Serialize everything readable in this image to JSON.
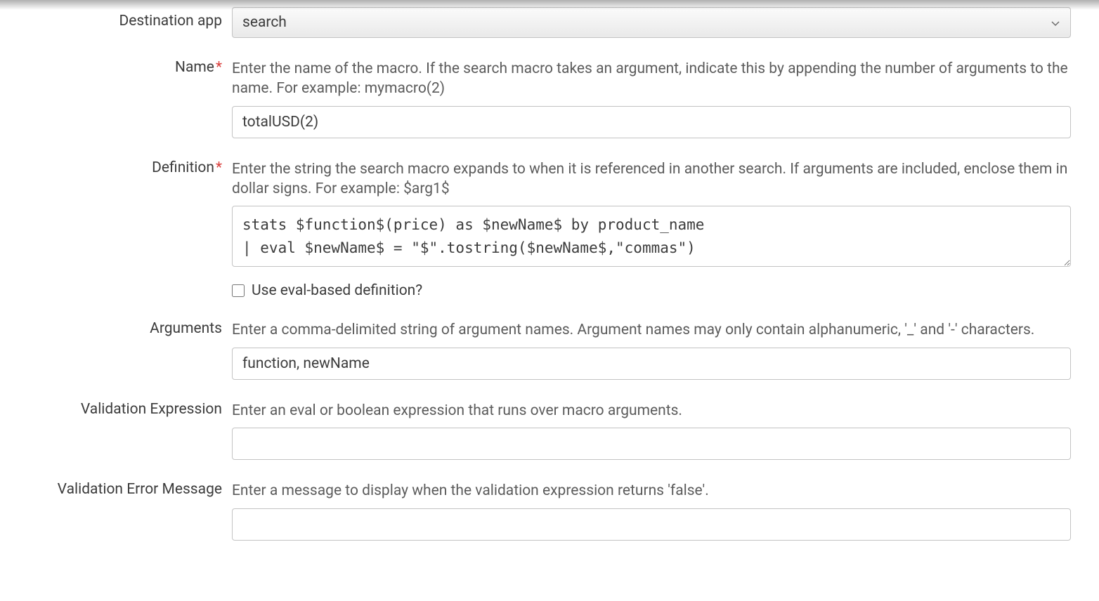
{
  "form": {
    "destinationApp": {
      "label": "Destination app",
      "value": "search"
    },
    "name": {
      "label": "Name",
      "required": "*",
      "help": "Enter the name of the macro. If the search macro takes an argument, indicate this by appending the number of arguments to the name. For example: mymacro(2)",
      "value": "totalUSD(2)"
    },
    "definition": {
      "label": "Definition",
      "required": "*",
      "help": "Enter the string the search macro expands to when it is referenced in another search. If arguments are included, enclose them in dollar signs. For example: $arg1$",
      "value": "stats $function$(price) as $newName$ by product_name\n| eval $newName$ = \"$\".tostring($newName$,\"commas\")",
      "evalCheckboxLabel": "Use eval-based definition?",
      "evalChecked": false
    },
    "arguments": {
      "label": "Arguments",
      "help": "Enter a comma-delimited string of argument names. Argument names may only contain alphanumeric, '_' and '-' characters.",
      "value": "function, newName"
    },
    "validationExpression": {
      "label": "Validation Expression",
      "help": "Enter an eval or boolean expression that runs over macro arguments.",
      "value": ""
    },
    "validationErrorMessage": {
      "label": "Validation Error Message",
      "help": "Enter a message to display when the validation expression returns 'false'.",
      "value": ""
    }
  }
}
